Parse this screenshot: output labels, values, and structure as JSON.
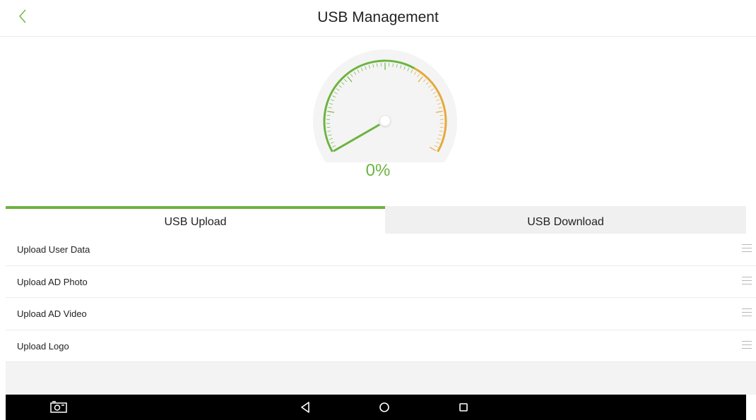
{
  "header": {
    "title": "USB Management",
    "back_icon": "chevron-left-icon"
  },
  "gauge": {
    "value_percent": 0,
    "label": "0%",
    "accent": "#6db33f",
    "warn": "#e5a93a"
  },
  "tabs": [
    {
      "label": "USB Upload",
      "active": true
    },
    {
      "label": "USB Download",
      "active": false
    }
  ],
  "items": [
    {
      "label": "Upload User Data",
      "icon": "menu-icon"
    },
    {
      "label": "Upload AD Photo",
      "icon": "menu-icon"
    },
    {
      "label": "Upload AD Video",
      "icon": "menu-icon"
    },
    {
      "label": "Upload Logo",
      "icon": "menu-icon"
    }
  ],
  "navbar": {
    "icons": [
      "screenshot-icon",
      "back-triangle-icon",
      "home-circle-icon",
      "recents-square-icon"
    ]
  }
}
